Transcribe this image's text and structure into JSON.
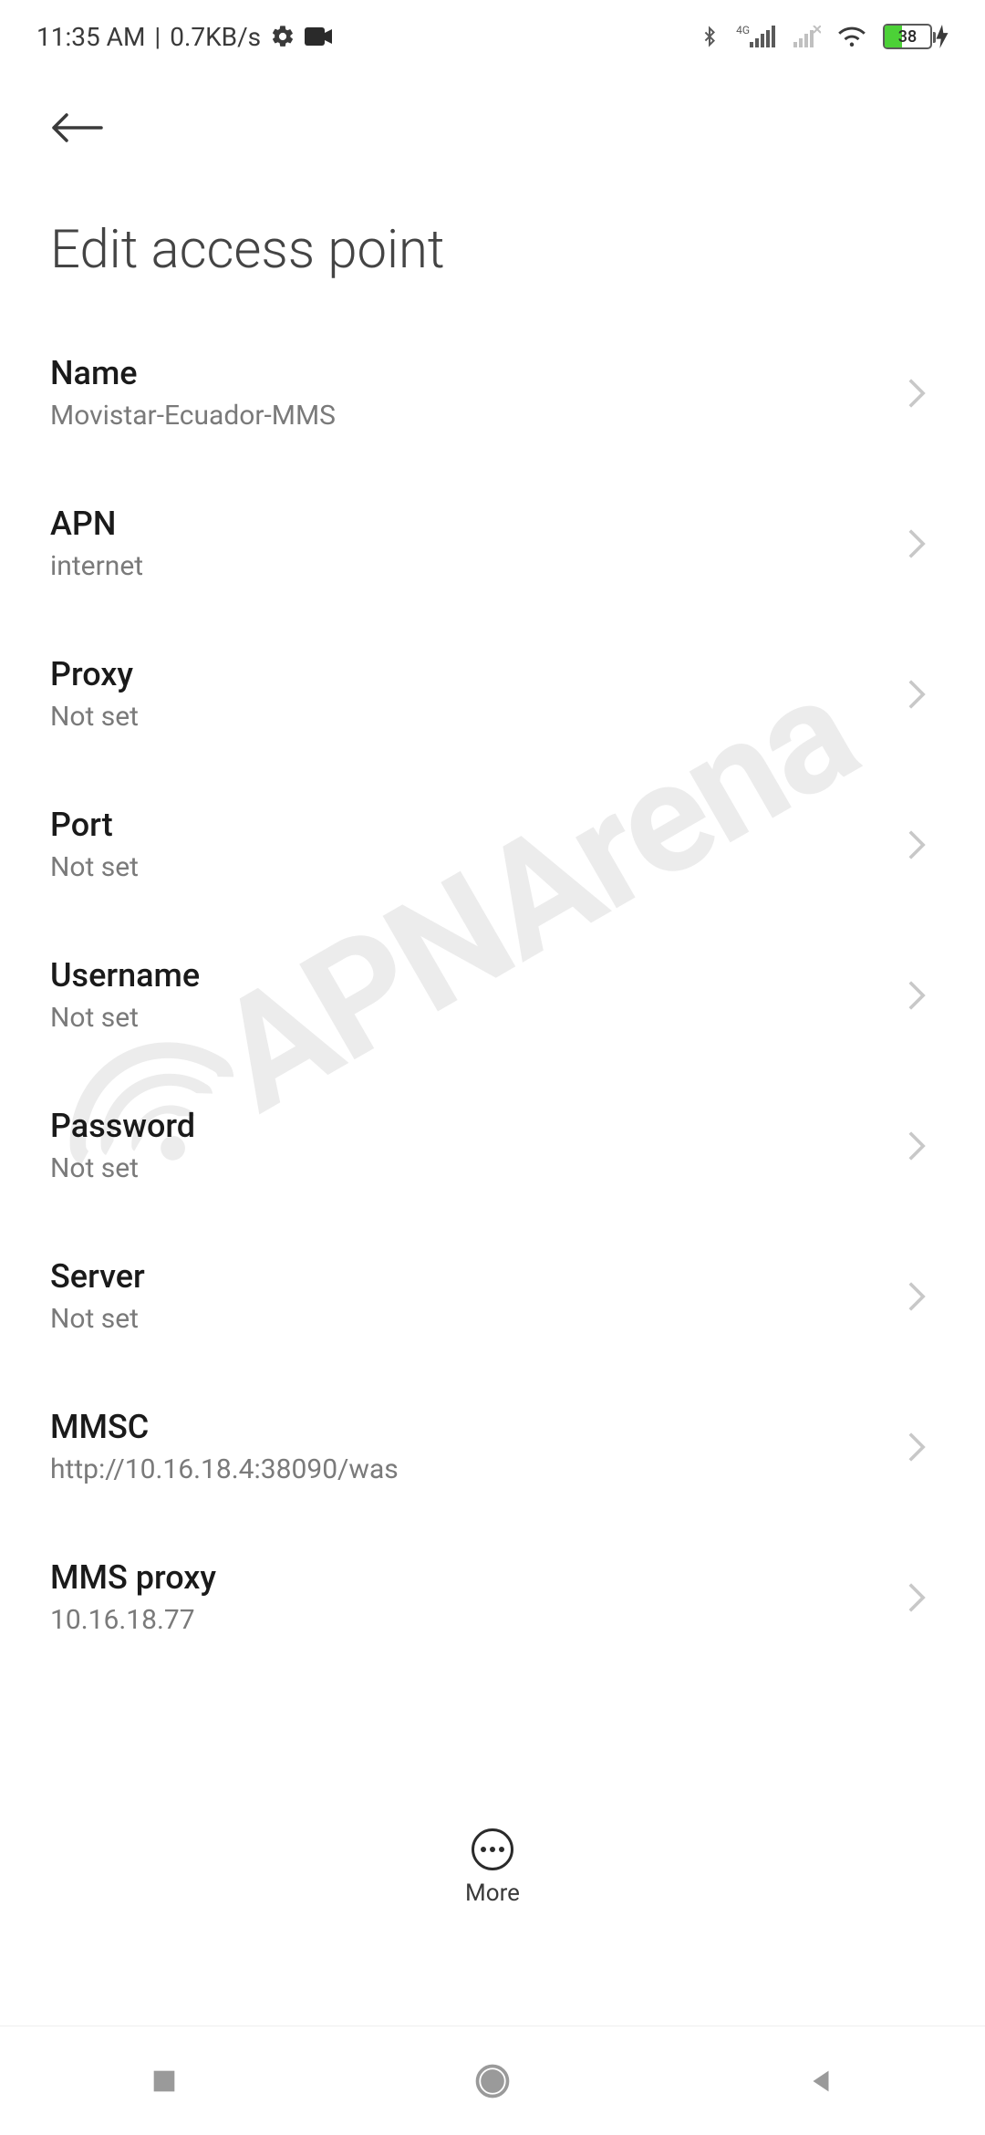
{
  "status": {
    "time": "11:35 AM",
    "separator": "|",
    "net_speed": "0.7KB/s",
    "network_badge": "4G",
    "battery_pct": "38"
  },
  "page": {
    "title": "Edit access point"
  },
  "settings": [
    {
      "label": "Name",
      "value": "Movistar-Ecuador-MMS"
    },
    {
      "label": "APN",
      "value": "internet"
    },
    {
      "label": "Proxy",
      "value": "Not set"
    },
    {
      "label": "Port",
      "value": "Not set"
    },
    {
      "label": "Username",
      "value": "Not set"
    },
    {
      "label": "Password",
      "value": "Not set"
    },
    {
      "label": "Server",
      "value": "Not set"
    },
    {
      "label": "MMSC",
      "value": "http://10.16.18.4:38090/was"
    },
    {
      "label": "MMS proxy",
      "value": "10.16.18.77"
    }
  ],
  "bottom": {
    "more": "More"
  },
  "watermark": "APNArena"
}
